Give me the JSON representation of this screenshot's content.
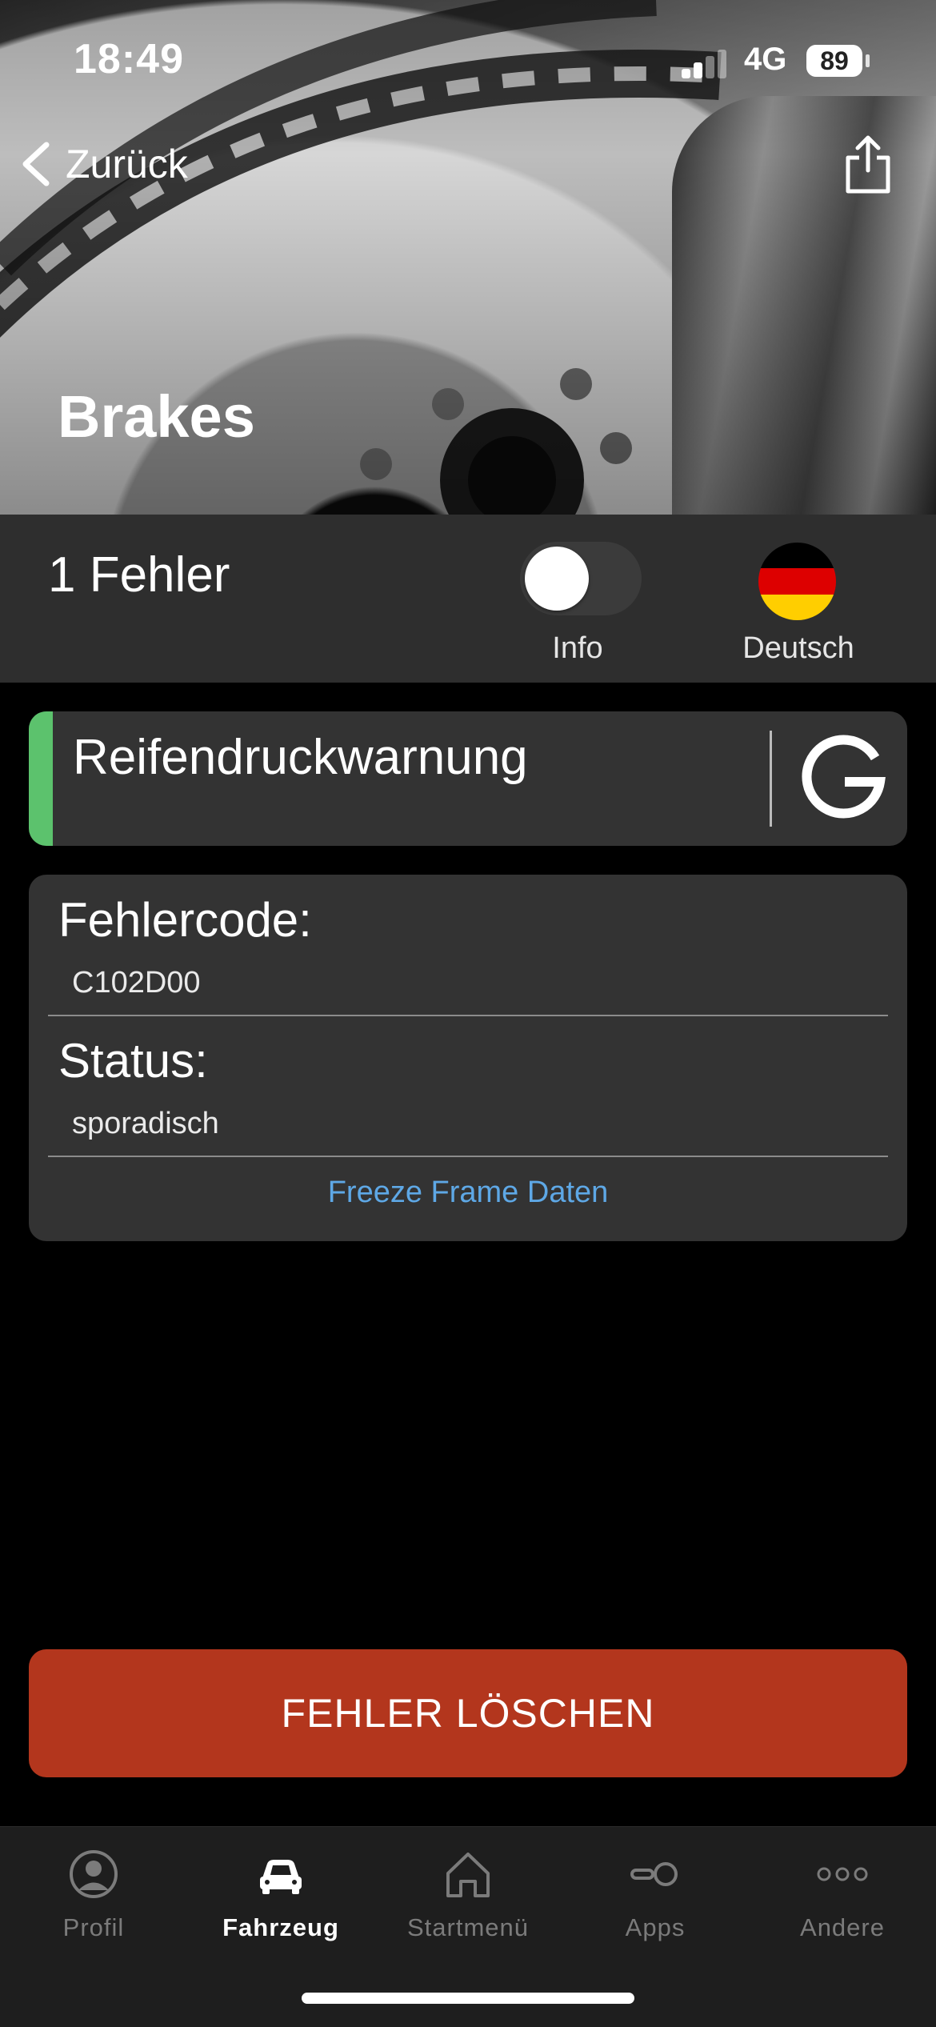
{
  "status_bar": {
    "time": "18:49",
    "network": "4G",
    "battery": "89"
  },
  "nav": {
    "back_label": "Zurück"
  },
  "hero": {
    "title": "Brakes"
  },
  "summary": {
    "error_count": "1 Fehler",
    "info_toggle_label": "Info",
    "info_toggle_on": false,
    "language_label": "Deutsch"
  },
  "fault": {
    "name": "Reifendruckwarnung",
    "accent_color": "#5cc26d"
  },
  "details": {
    "code_label": "Fehlercode:",
    "code_value": "C102D00",
    "status_label": "Status:",
    "status_value": "sporadisch",
    "freeze_frame_link": "Freeze Frame Daten"
  },
  "actions": {
    "delete_button": "FEHLER LÖSCHEN",
    "delete_color": "#b3361d"
  },
  "tabbar": {
    "items": [
      {
        "label": "Profil",
        "icon": "profile-icon",
        "active": false
      },
      {
        "label": "Fahrzeug",
        "icon": "car-icon",
        "active": true
      },
      {
        "label": "Startmenü",
        "icon": "home-icon",
        "active": false
      },
      {
        "label": "Apps",
        "icon": "apps-icon",
        "active": false
      },
      {
        "label": "Andere",
        "icon": "more-icon",
        "active": false
      }
    ]
  }
}
